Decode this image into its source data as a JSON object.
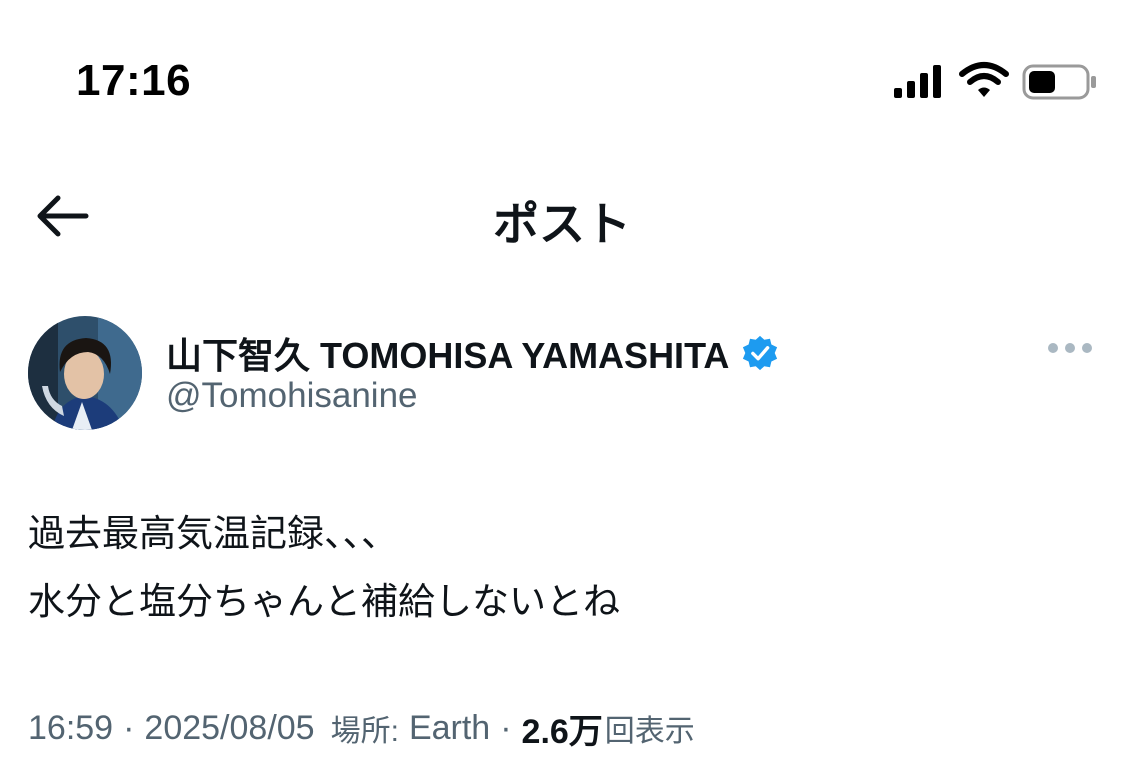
{
  "status_bar": {
    "time": "17:16",
    "signal_icon": "cellular-signal-icon",
    "wifi_icon": "wifi-icon",
    "battery_icon": "battery-icon"
  },
  "nav": {
    "title": "ポスト",
    "back_icon": "back-arrow-icon"
  },
  "post": {
    "author": {
      "display_name": "山下智久 TOMOHISA YAMASHITA",
      "handle": "@Tomohisanine",
      "verified": true
    },
    "text_lines": [
      "過去最高気温記録、、、",
      "水分と塩分ちゃんと補給しないとね"
    ],
    "meta": {
      "time": "16:59",
      "sep": "·",
      "date": "2025/08/05",
      "location_label": "場所:",
      "location": "Earth",
      "views_count": "2.6万",
      "views_label": "回表示"
    }
  },
  "colors": {
    "text_primary": "#0f1419",
    "text_secondary": "#536471",
    "verified_blue": "#1d9bf0"
  }
}
